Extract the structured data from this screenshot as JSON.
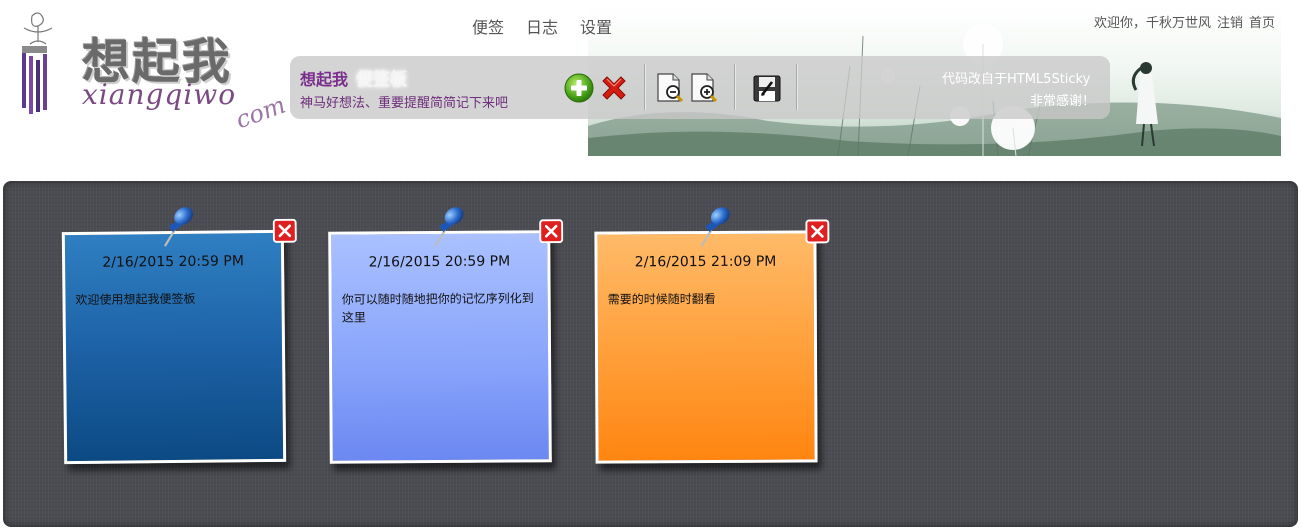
{
  "header": {
    "logo": {
      "han": "想起我",
      "pinyin": "xiangqiwo",
      "com": "com"
    },
    "nav": [
      {
        "label": "便签"
      },
      {
        "label": "日志"
      },
      {
        "label": "设置"
      }
    ],
    "top_links": {
      "welcome": "欢迎你，千秋万世风",
      "logout": "注销",
      "home": "首页"
    }
  },
  "toolbar": {
    "title": "想起我",
    "title_ghost": "便签板",
    "subtitle": "神马好想法、重要提醒简简记下来吧",
    "credit_line1": "代码改自于HTML5Sticky",
    "credit_line2": "非常感谢！",
    "buttons": [
      {
        "icon": "add-icon"
      },
      {
        "icon": "delete-all-icon"
      },
      {
        "icon": "zoom-out-icon"
      },
      {
        "icon": "zoom-in-icon"
      },
      {
        "icon": "save-icon"
      }
    ]
  },
  "notes": [
    {
      "time": "2/16/2015 20:59 PM",
      "text": "欢迎使用想起我便签板",
      "color": "#1d62a6"
    },
    {
      "time": "2/16/2015 20:59 PM",
      "text": "你可以随时随地把你的记忆序列化到这里",
      "color": "#8aa6fb"
    },
    {
      "time": "2/16/2015 21:09 PM",
      "text": "需要的时候随时翻看",
      "color": "#ff9e38"
    }
  ],
  "colors": {
    "accent_purple": "#7a2f8c",
    "board": "#4b4c52",
    "close_red": "#e02020"
  }
}
